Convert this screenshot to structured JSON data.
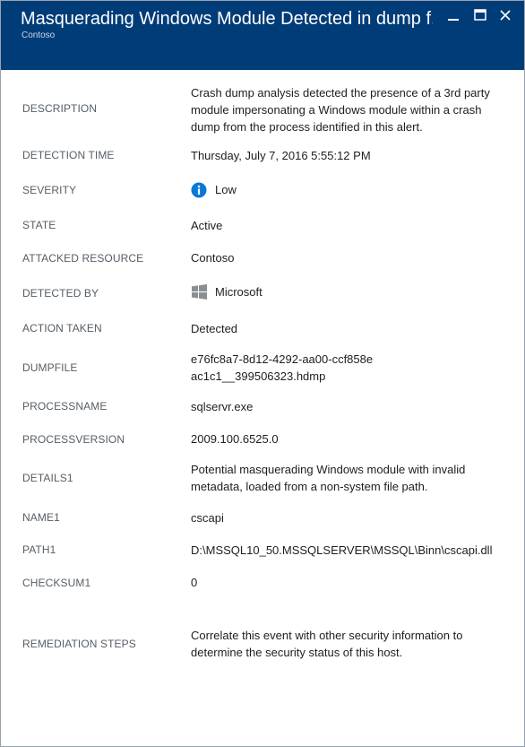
{
  "header": {
    "title": "Masquerading Windows Module Detected in dump f...",
    "subtitle": "Contoso",
    "background_color": "#003c78"
  },
  "window_controls": [
    "minimize-icon",
    "maximize-icon",
    "close-icon"
  ],
  "fields": {
    "description": {
      "label": "DESCRIPTION",
      "value": "Crash dump analysis detected the presence of a 3rd party module impersonating a Windows module within a crash dump from the process identified in this alert."
    },
    "detection_time": {
      "label": "DETECTION TIME",
      "value": "Thursday, July 7, 2016 5:55:12 PM"
    },
    "severity": {
      "label": "SEVERITY",
      "value": "Low",
      "icon": "info-icon",
      "icon_color": "#0a78d7"
    },
    "state": {
      "label": "STATE",
      "value": "Active"
    },
    "attacked_resource": {
      "label": "ATTACKED RESOURCE",
      "value": "Contoso"
    },
    "detected_by": {
      "label": "DETECTED BY",
      "value": "Microsoft",
      "icon": "windows-logo-icon"
    },
    "action_taken": {
      "label": "ACTION TAKEN",
      "value": "Detected"
    },
    "dumpfile": {
      "label": "DUMPFILE",
      "value": "e76fc8a7-8d12-4292-aa00-ccf858eac1c1__399506323.hdmp"
    },
    "processname": {
      "label": "PROCESSNAME",
      "value": "sqlservr.exe"
    },
    "processversion": {
      "label": "PROCESSVERSION",
      "value": "2009.100.6525.0"
    },
    "details1": {
      "label": "DETAILS1",
      "value": "Potential masquerading Windows module with invalid metadata, loaded from a non-system file path."
    },
    "name1": {
      "label": "NAME1",
      "value": "cscapi"
    },
    "path1": {
      "label": "PATH1",
      "value": "D:\\MSSQL10_50.MSSQLSERVER\\MSSQL\\Binn\\cscapi.dll"
    },
    "checksum1": {
      "label": "CHECKSUM1",
      "value": "0"
    },
    "remediation_steps": {
      "label": "REMEDIATION STEPS",
      "value": "Correlate this event with other security information to determine the security status of this host."
    }
  }
}
